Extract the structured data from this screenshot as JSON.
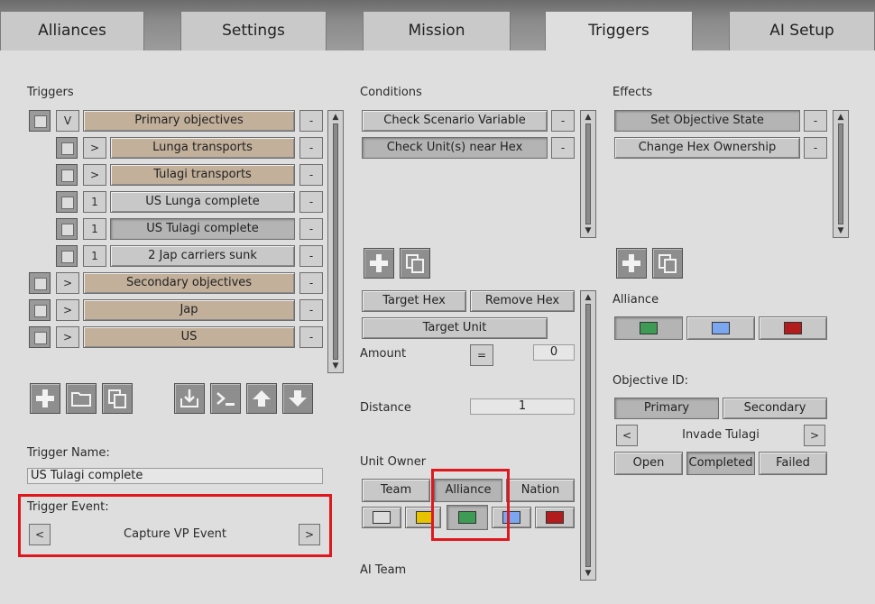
{
  "tabs": [
    {
      "label": "Alliances"
    },
    {
      "label": "Settings"
    },
    {
      "label": "Mission"
    },
    {
      "label": "Triggers",
      "active": true
    },
    {
      "label": "AI Setup"
    }
  ],
  "triggers": {
    "section_label": "Triggers",
    "items": [
      {
        "label": "Primary objectives",
        "toggle": "V",
        "indent": 0,
        "group": true
      },
      {
        "label": "Lunga transports",
        "toggle": ">",
        "indent": 1,
        "group": true
      },
      {
        "label": "Tulagi transports",
        "toggle": ">",
        "indent": 1,
        "group": true
      },
      {
        "label": "US Lunga complete",
        "toggle": "1",
        "indent": 1,
        "group": false
      },
      {
        "label": "US Tulagi complete",
        "toggle": "1",
        "indent": 1,
        "group": false,
        "selected": true
      },
      {
        "label": "2 Jap carriers sunk",
        "toggle": "1",
        "indent": 1,
        "group": false
      },
      {
        "label": "Secondary objectives",
        "toggle": ">",
        "indent": 0,
        "group": true
      },
      {
        "label": "Jap",
        "toggle": ">",
        "indent": 0,
        "group": true
      },
      {
        "label": "US",
        "toggle": ">",
        "indent": 0,
        "group": true
      }
    ],
    "remove_label": "-",
    "name_label": "Trigger Name:",
    "name_value": "US Tulagi complete",
    "event_label": "Trigger Event:",
    "event_value": "Capture VP Event",
    "prev_label": "<",
    "next_label": ">"
  },
  "conditions": {
    "section_label": "Conditions",
    "items": [
      {
        "label": "Check Scenario Variable"
      },
      {
        "label": "Check Unit(s) near Hex",
        "selected": true
      }
    ],
    "remove_label": "-",
    "target_hex": "Target Hex",
    "remove_hex": "Remove Hex",
    "target_unit": "Target Unit",
    "amount_label": "Amount",
    "amount_op": "=",
    "amount_value": "0",
    "distance_label": "Distance",
    "distance_value": "1",
    "unit_owner_label": "Unit Owner",
    "owner_team": "Team",
    "owner_alliance": "Alliance",
    "owner_nation": "Nation",
    "ai_team_label": "AI Team"
  },
  "effects": {
    "section_label": "Effects",
    "items": [
      {
        "label": "Set Objective State",
        "selected": true
      },
      {
        "label": "Change Hex Ownership"
      }
    ],
    "remove_label": "-",
    "alliance_label": "Alliance",
    "objective_label": "Objective ID:",
    "primary": "Primary",
    "secondary": "Secondary",
    "objective_prev": "<",
    "objective_value": "Invade Tulagi",
    "objective_next": ">",
    "state_open": "Open",
    "state_completed": "Completed",
    "state_failed": "Failed"
  },
  "colors": {
    "white": "#dcdcdc",
    "yellow": "#e6c200",
    "green": "#3e9b56",
    "blue": "#7aa7ef",
    "red": "#b21c1c",
    "highlight": "#e0181e"
  }
}
